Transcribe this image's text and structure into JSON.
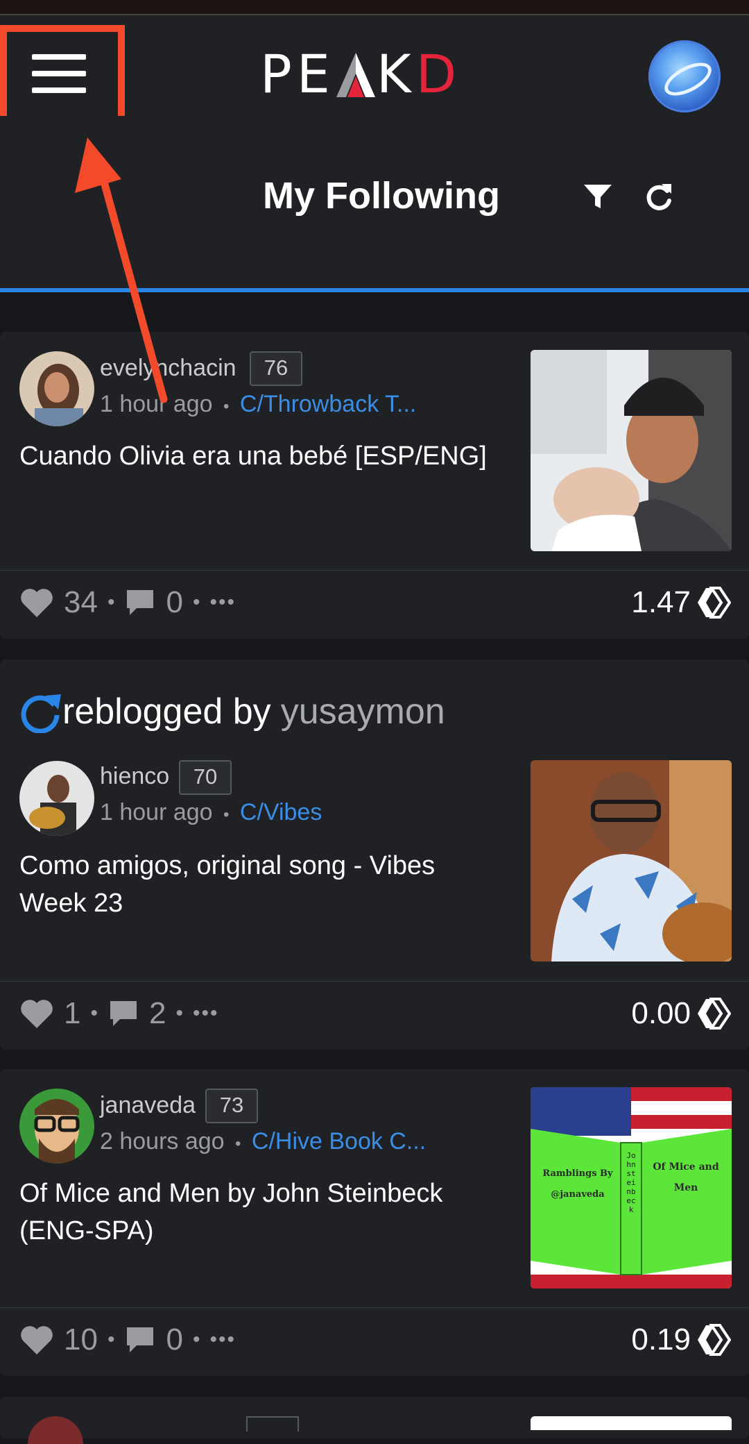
{
  "header": {
    "logo_letters": [
      "P",
      "E",
      "A",
      "K",
      "D"
    ],
    "page_title": "My Following"
  },
  "posts": [
    {
      "author": "evelynchacin",
      "reputation": "76",
      "time": "1 hour ago",
      "separator": "•",
      "community": "C/Throwback T...",
      "title": "Cuando Olivia era una bebé [ESP/ENG]",
      "votes": "34",
      "comments": "0",
      "payout": "1.47"
    },
    {
      "reblog_text": "reblogged by",
      "reblog_user": "yusaymon",
      "author": "hienco",
      "reputation": "70",
      "time": "1 hour ago",
      "separator": "•",
      "community": "C/Vibes",
      "title": "Como amigos, original song - Vibes Week 23",
      "votes": "1",
      "comments": "2",
      "payout": "0.00"
    },
    {
      "author": "janaveda",
      "reputation": "73",
      "time": "2 hours ago",
      "separator": "•",
      "community": "C/Hive Book C...",
      "title": "Of Mice and Men by John Steinbeck (ENG-SPA)",
      "votes": "10",
      "comments": "0",
      "payout": "0.19",
      "thumb_text": {
        "left": "Ramblings By @janaveda",
        "right": "Of Mice and Men",
        "spine": "John steinbeck"
      }
    }
  ],
  "stat_dot": "•",
  "more_label": "•••",
  "colors": {
    "accent": "#2a86e6",
    "brand_red": "#e3243b",
    "annotation": "#f24a2a",
    "card_bg": "#1f2125",
    "page_bg": "#16181b"
  },
  "icons": [
    "menu-icon",
    "filter-icon",
    "refresh-icon",
    "heart-icon",
    "comment-icon",
    "more-icon",
    "hive-icon",
    "reblog-icon"
  ]
}
